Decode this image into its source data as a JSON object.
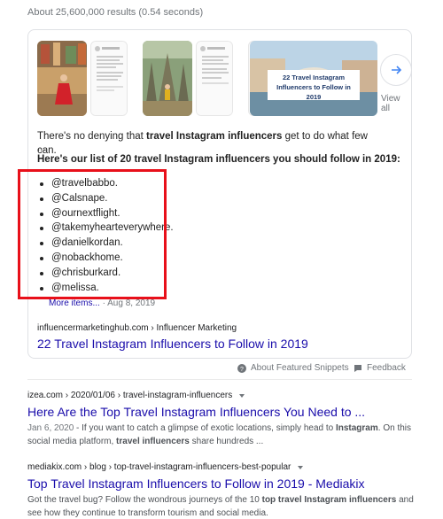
{
  "stats": "About 25,600,000 results (0.54 seconds)",
  "featured_snippet": {
    "thumbnails": [
      {
        "icon": "travel-photo-woman-red-dress-thumbnail"
      },
      {
        "icon": "travel-photo-temple-ruins-thumbnail"
      },
      {
        "icon": "travel-photo-instagram-grid-thumbnail"
      },
      {
        "icon": "venice-bridge-thumbnail",
        "caption": "22 Travel Instagram Influencers to Follow in 2019"
      }
    ],
    "view_all": "View all",
    "intro_plain": "There's no denying that ",
    "intro_bold": "travel Instagram influencers",
    "intro_tail": " get to do what few can.",
    "ellipsis": "...",
    "list_heading": "Here's our list of 20 travel Instagram influencers you should follow in 2019:",
    "handles": [
      "@travelbabbo.",
      "@Calsnape.",
      "@ournextflight.",
      "@takemyhearteverywhere.",
      "@danielkordan.",
      "@nobackhome.",
      "@chrisburkard.",
      "@melissa."
    ],
    "more_items": "More items...",
    "more_date": "Aug 8, 2019",
    "source": "influencermarketinghub.com › Influencer Marketing",
    "title": "22 Travel Instagram Influencers to Follow in 2019",
    "highlight_color": "#e8101a"
  },
  "footer": {
    "about": "About Featured Snippets",
    "feedback": "Feedback"
  },
  "results": [
    {
      "cite": "izea.com › 2020/01/06 › travel-instagram-influencers",
      "title": "Here Are the Top Travel Instagram Influencers You Need to ...",
      "date": "Jan 6, 2020",
      "snippet_1": " - If you want to catch a glimpse of exotic locations, simply head to ",
      "snippet_b1": "Instagram",
      "snippet_2": ". On this social media platform, ",
      "snippet_b2": "travel influencers",
      "snippet_3": " share hundreds ..."
    },
    {
      "cite": "mediakix.com › blog › top-travel-instagram-influencers-best-popular",
      "title": "Top Travel Instagram Influencers to Follow in 2019 - Mediakix",
      "snippet_1": "Got the travel bug? Follow the wondrous journeys of the 10 ",
      "snippet_b1": "top travel Instagram influencers",
      "snippet_2": " and see how they continue to transform tourism and social media."
    }
  ],
  "colors": {
    "link": "#1a0dab",
    "meta": "#70757a",
    "border": "#dfe1e5",
    "arrow": "#4285f4"
  }
}
